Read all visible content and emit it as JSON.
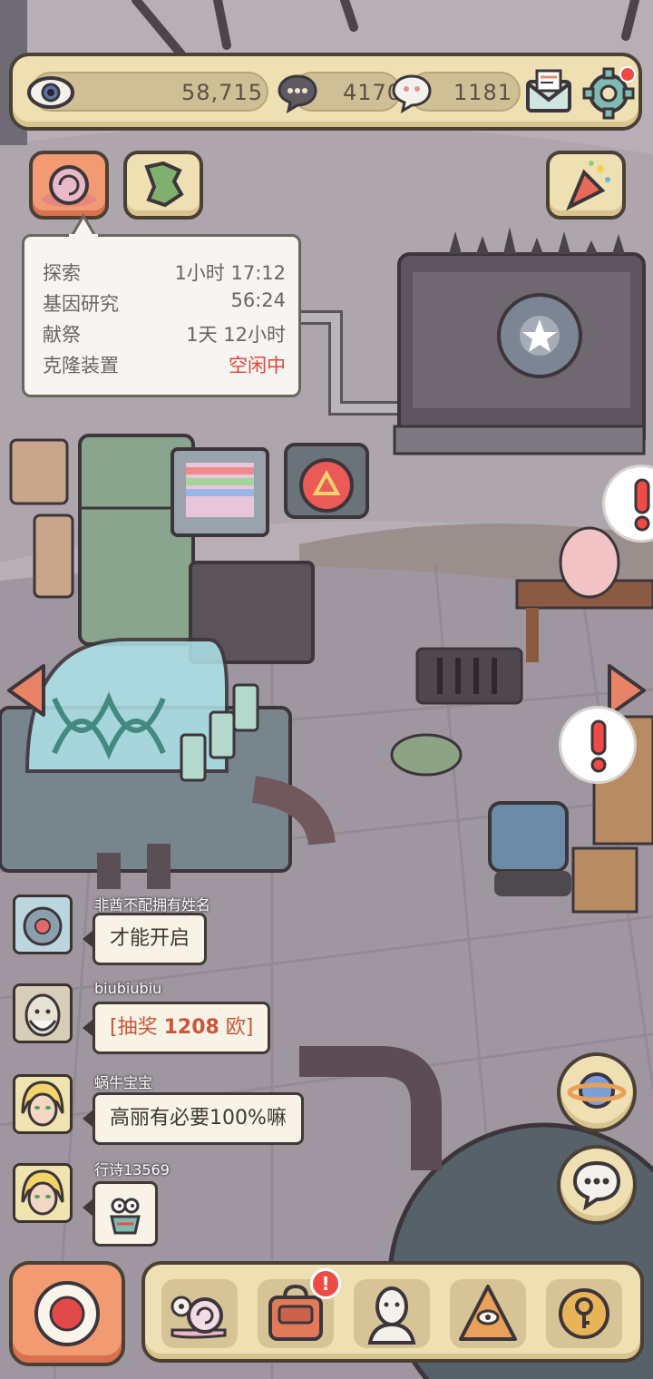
{
  "topbar": {
    "eye_count": "58,715",
    "chat_currency": "4170",
    "bubble_currency": "1181"
  },
  "status_panel": {
    "rows": [
      {
        "label": "探索",
        "value": "1小时  17:12",
        "state": "normal"
      },
      {
        "label": "基因研究",
        "value": "56:24",
        "state": "normal"
      },
      {
        "label": "献祭",
        "value": "1天  12小时",
        "state": "normal"
      },
      {
        "label": "克隆装置",
        "value": "空闲中",
        "state": "idle"
      }
    ]
  },
  "chat": {
    "messages": [
      {
        "name": "非酋不配拥有姓名",
        "text": "才能开启",
        "avatar": "robot-avatar"
      },
      {
        "name": "biubiubiu",
        "text_prefix": "[抽奖 ",
        "text_amount": "1208",
        "text_suffix": " 欧]",
        "avatar": "old-man-avatar"
      },
      {
        "name": "蜗牛宝宝",
        "text": "高丽有必要100%嘛",
        "avatar": "blonde-avatar"
      },
      {
        "name": "行诗13569",
        "text": "",
        "avatar": "blonde-avatar"
      }
    ]
  },
  "colors": {
    "panel_bg": "#efe0b3",
    "outline": "#4a4036",
    "alert_red": "#ee4a46",
    "idle_red": "#e0453a",
    "lottery_orange": "#c9563a"
  },
  "icons": {
    "top_left_buttons": [
      "snail-shell-icon",
      "map-icon"
    ],
    "top_right_button": "party-popper-icon",
    "bottom_nav": [
      "snail-icon",
      "backpack-icon",
      "statue-icon",
      "pyramid-eye-icon",
      "key-coin-icon"
    ],
    "right_round": [
      "planet-icon",
      "chat-bubble-icon"
    ]
  }
}
